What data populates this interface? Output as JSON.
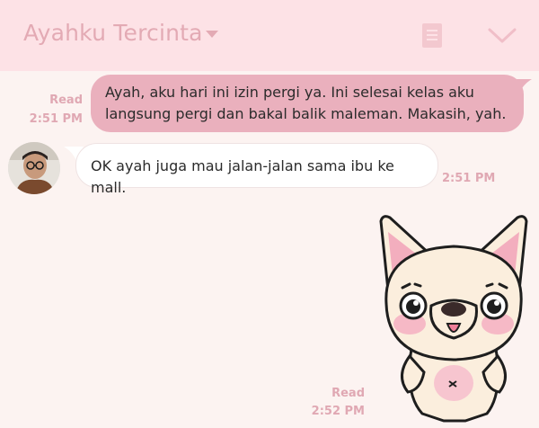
{
  "header": {
    "title": "Ayahku Tercinta"
  },
  "messages": [
    {
      "direction": "outgoing",
      "text": "Ayah, aku hari ini izin pergi ya. Ini selesai kelas aku\nlangsung pergi dan bakal balik maleman. Makasih, yah.",
      "status": "Read",
      "time": "2:51 PM"
    },
    {
      "direction": "incoming",
      "text": "OK ayah juga mau jalan-jalan sama ibu ke mall.",
      "time": "2:51 PM"
    },
    {
      "direction": "outgoing",
      "type": "sticker",
      "sticker": "french-bulldog-blushing",
      "status": "Read",
      "time": "2:52 PM"
    }
  ],
  "colors": {
    "header_bg": "#fde2e6",
    "chat_bg": "#fcf3f1",
    "outgoing_bubble": "#eab0bd",
    "incoming_bubble": "#ffffff",
    "accent": "#e3aab4"
  },
  "icons": {
    "title_dropdown": "caret-down-icon",
    "menu": "notes-menu-icon",
    "collapse": "chevron-down-icon"
  }
}
